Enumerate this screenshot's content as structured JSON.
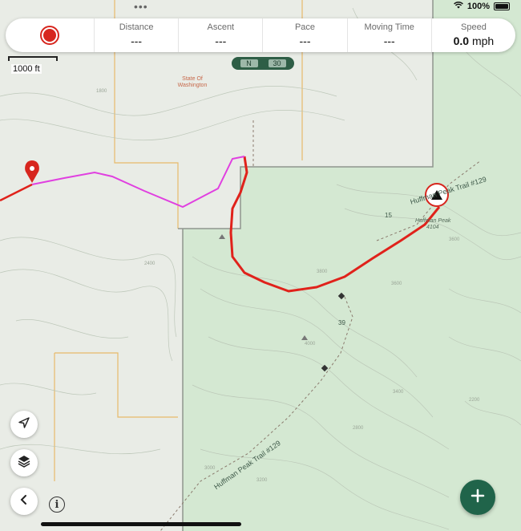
{
  "status": {
    "battery_text": "100%"
  },
  "stats": [
    {
      "label": "Distance",
      "value": "---"
    },
    {
      "label": "Ascent",
      "value": "---"
    },
    {
      "label": "Pace",
      "value": "---"
    },
    {
      "label": "Moving Time",
      "value": "---"
    },
    {
      "label": "Speed",
      "value": "0.0",
      "unit": "mph"
    }
  ],
  "scale_label": "1000 ft",
  "heading": {
    "dir": "N",
    "value": "30"
  },
  "map": {
    "land_label": "State Of\nWashington",
    "peak_name": "Huffman Peak",
    "peak_elevation": "4104",
    "trail_label_top": "Huffman Peak Trail #129",
    "trail_label_bottom": "Huffman Peak Trail #129",
    "contour_labels": [
      "3600",
      "3600",
      "4000",
      "3800",
      "3400",
      "3000",
      "3200",
      "2800",
      "2400",
      "1800",
      "2200"
    ],
    "road_numbers": [
      "15",
      "39"
    ],
    "colors": {
      "track": "#e0221b",
      "route": "#e040e0",
      "forest": "#d3e8d0",
      "public_land": "#e8ebe5",
      "boundary": "#e8b96a"
    }
  },
  "icons": {
    "record": "record-icon",
    "location": "location-arrow-icon",
    "layers": "layers-icon",
    "back": "chevron-left-icon",
    "info": "info-icon",
    "add": "plus-icon",
    "pin": "map-pin-icon",
    "peak": "peak-icon"
  }
}
